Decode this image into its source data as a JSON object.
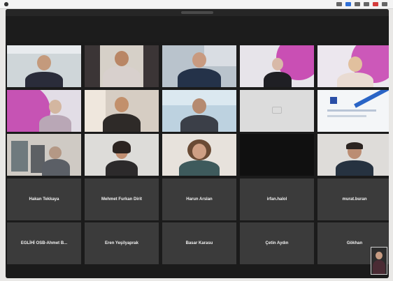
{
  "participants_text": [
    "Hakan Tekkaya",
    "Mehmet Furkan Dirit",
    "Harun Arslan",
    "irfan.halol",
    "murat.buran",
    "EGLİHİ OSB-Ahmet B...",
    "Eren Yeşilyaprak",
    "Basar Karasu",
    "Çetin Aydın",
    "Gökhan"
  ],
  "video_tiles": [
    {
      "icon": "person-video"
    },
    {
      "icon": "person-video"
    },
    {
      "icon": "person-video"
    },
    {
      "icon": "presentation-video"
    },
    {
      "icon": "presentation-video"
    },
    {
      "icon": "presentation-video"
    },
    {
      "icon": "person-video"
    },
    {
      "icon": "person-video"
    },
    {
      "icon": "blank-video"
    },
    {
      "icon": "document-video"
    },
    {
      "icon": "person-video"
    },
    {
      "icon": "person-video"
    },
    {
      "icon": "person-video"
    },
    {
      "icon": "camera-off"
    },
    {
      "icon": "person-video"
    }
  ],
  "colors": {
    "window_bg": "#1b1b1b",
    "tile_bg": "#3b3b3b",
    "accent_magenta": "#c94fb4",
    "menubar_blue": "#2f6fd6",
    "menubar_red": "#d43c3c"
  }
}
